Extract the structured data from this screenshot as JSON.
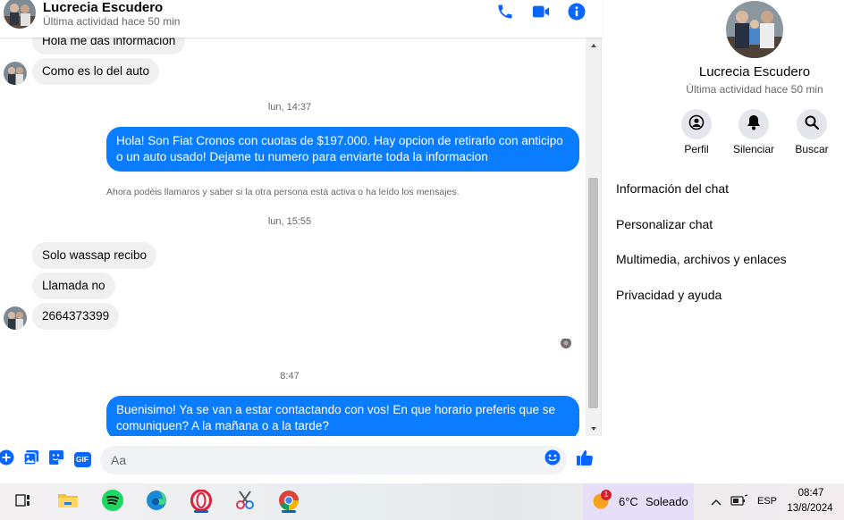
{
  "header": {
    "name": "Lucrecia Escudero",
    "status": "Última actividad hace 50 min"
  },
  "messages": [
    {
      "kind": "in",
      "text": "Hola me das información"
    },
    {
      "kind": "in",
      "text": "Como es lo del auto"
    },
    {
      "kind": "timestamp",
      "text": "lun, 14:37"
    },
    {
      "kind": "out",
      "text": "Hola! Son Fiat Cronos con cuotas de $197.000. Hay opcion de retirarlo con anticipo o un auto usado! Dejame tu numero para enviarte toda la informacion"
    },
    {
      "kind": "note",
      "text": "Ahora podéis llamaros y saber si la otra persona está activa o ha leído los mensajes."
    },
    {
      "kind": "timestamp",
      "text": "lun, 15:55"
    },
    {
      "kind": "in",
      "text": "Solo wassap recibo"
    },
    {
      "kind": "in",
      "text": "Llamada no"
    },
    {
      "kind": "in",
      "text": "2664373399"
    },
    {
      "kind": "timestamp",
      "text": "8:47"
    },
    {
      "kind": "out",
      "text": "Buenisimo! Ya se van a estar contactando con vos! En que horario preferis que se comuniquen? A la mañana o a la tarde?"
    }
  ],
  "composer": {
    "placeholder": "Aa",
    "gif_label": "GIF"
  },
  "info": {
    "name": "Lucrecia Escudero",
    "status": "Última actividad hace 50 min",
    "actions": [
      {
        "label": "Perfil",
        "icon": "profile-icon"
      },
      {
        "label": "Silenciar",
        "icon": "bell-icon"
      },
      {
        "label": "Buscar",
        "icon": "search-icon"
      }
    ],
    "menu": [
      "Información del chat",
      "Personalizar chat",
      "Multimedia, archivos y enlaces",
      "Privacidad y ayuda"
    ]
  },
  "taskbar": {
    "weather_temp": "6°C",
    "weather_desc": "Soleado",
    "weather_badge": "1",
    "lang": "ESP",
    "time": "08:47",
    "date": "13/8/2024"
  },
  "colors": {
    "accent": "#0a7cff",
    "icon_blue": "#0866ff",
    "bubble_in": "#f0f0f0"
  }
}
